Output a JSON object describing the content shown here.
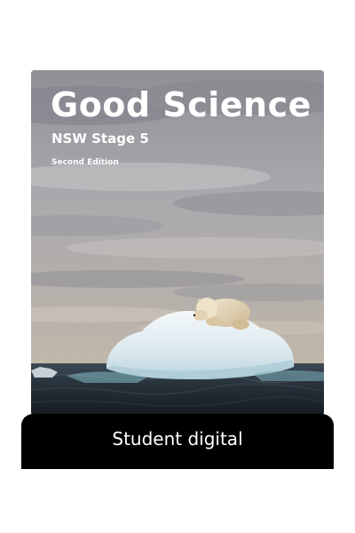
{
  "cover": {
    "title": "Good Science",
    "subtitle": "NSW Stage 5",
    "edition": "Second Edition",
    "image_description_icon": "polar-bear-on-iceberg-photo"
  },
  "banner": {
    "label": "Student digital"
  },
  "colors": {
    "page_background": "#ffffff",
    "banner_background": "#000000",
    "cover_text": "#ffffff",
    "sky": "#a7a7ac",
    "sea": "#1f2a33",
    "ice": "#e8f2f6"
  }
}
